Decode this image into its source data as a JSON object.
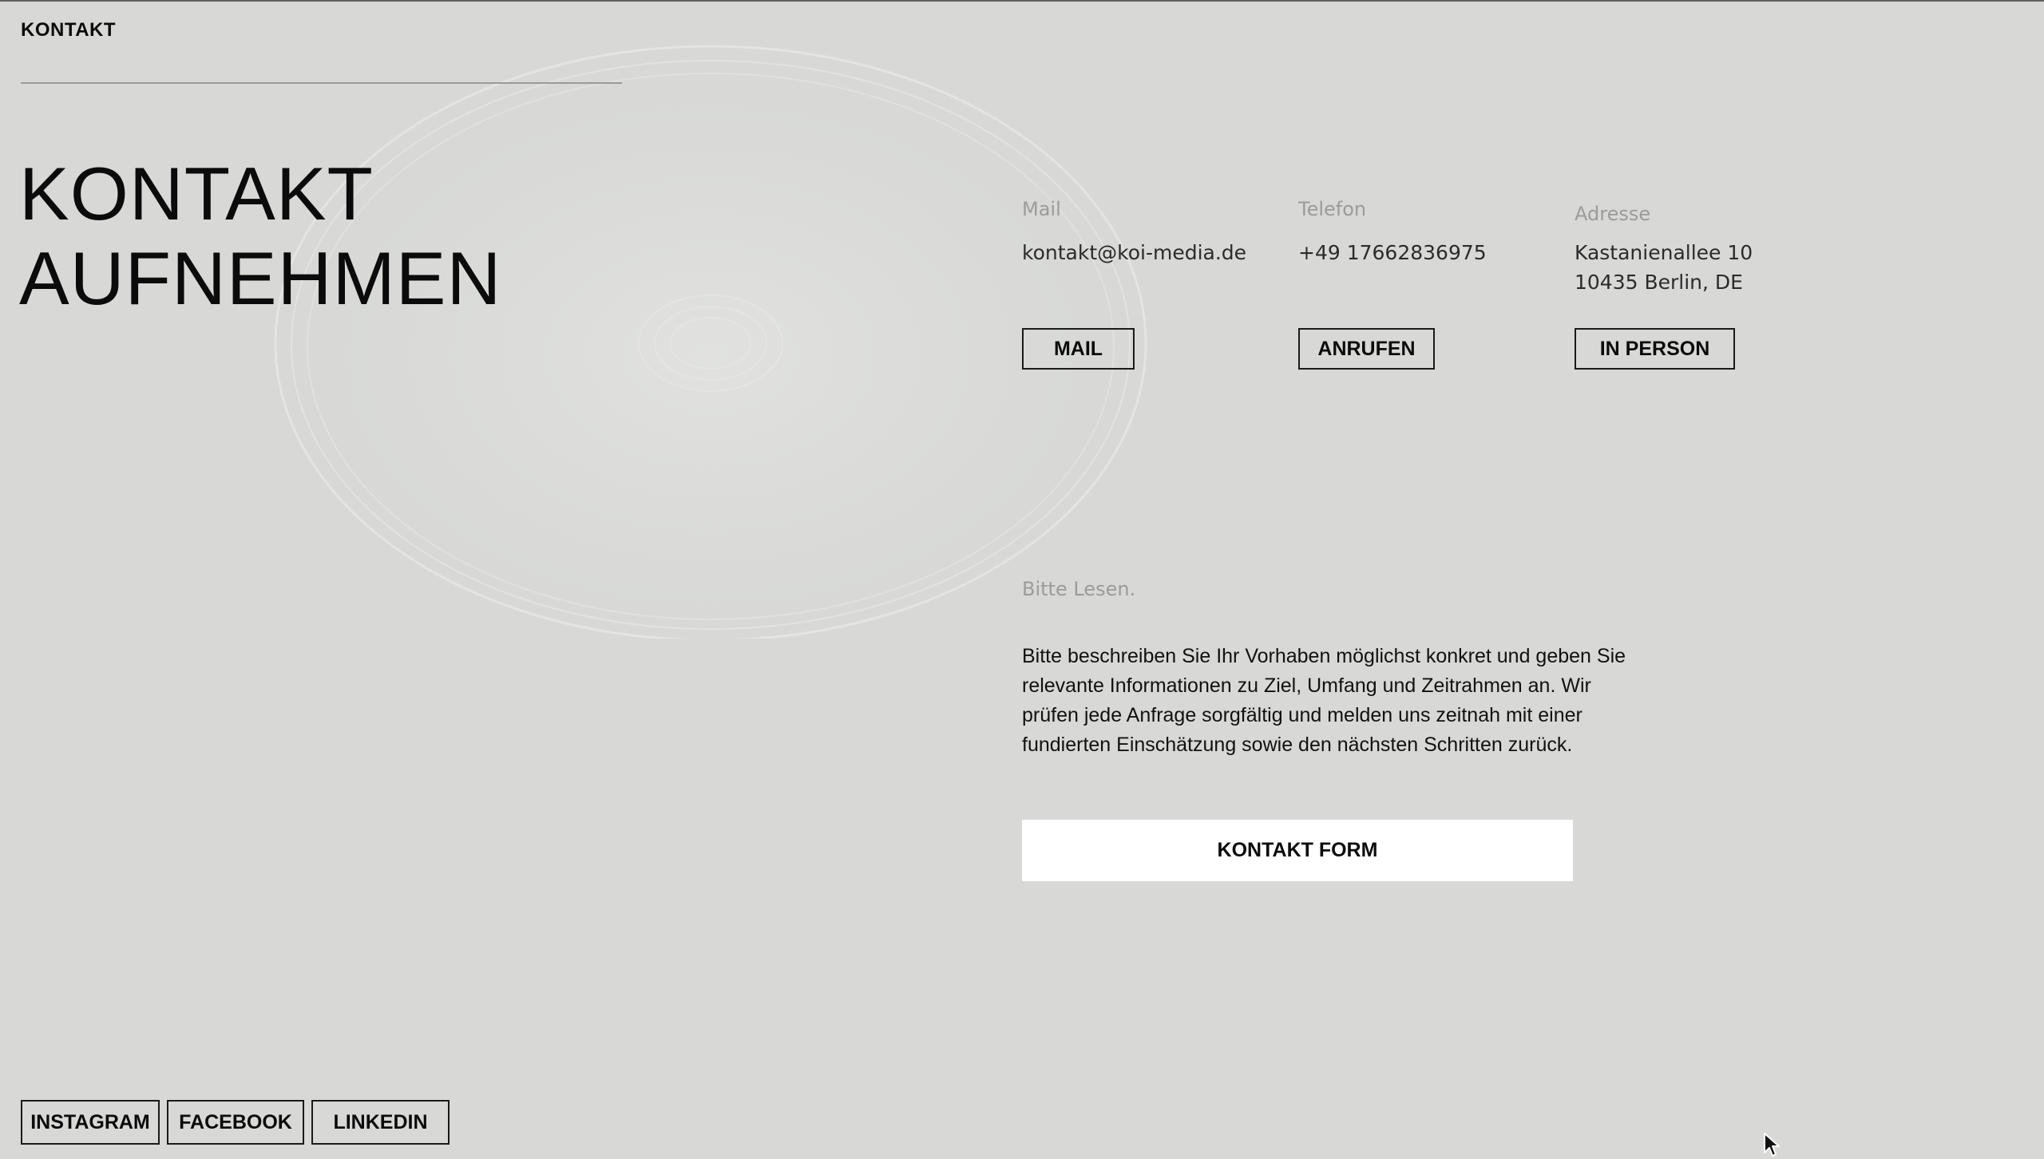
{
  "nav": {
    "label": "KONTAKT"
  },
  "headline": {
    "line1": "KONTAKT",
    "line2": "AUFNEHMEN"
  },
  "contact": {
    "mail": {
      "label": "Mail",
      "value": "kontakt@koi-media.de",
      "button": "MAIL"
    },
    "phone": {
      "label": "Telefon",
      "value": "+49 17662836975",
      "button": "ANRUFEN"
    },
    "address": {
      "label": "Adresse",
      "line1": "Kastanienallee 10",
      "line2": "10435 Berlin, DE",
      "button": "IN PERSON"
    }
  },
  "notice": {
    "label": "Bitte Lesen.",
    "text": "Bitte beschreiben Sie Ihr Vorhaben möglichst konkret und geben Sie relevante Informationen zu Ziel, Umfang und Zeitrahmen an. Wir prüfen jede Anfrage sorgfältig und melden uns zeitnah mit einer fundierten Einschätzung sowie den nächsten Schritten zurück."
  },
  "form_button": "KONTAKT FORM",
  "social": {
    "instagram": "INSTAGRAM",
    "facebook": "FACEBOOK",
    "linkedin": "LINKEDIN"
  },
  "colors": {
    "background": "#d8d9d6",
    "text": "#0b0b0b",
    "muted_label": "#9a9c99",
    "form_button_bg": "#ffffff"
  }
}
